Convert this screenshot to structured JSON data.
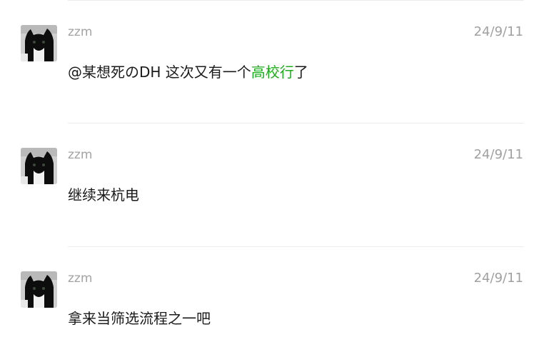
{
  "comments": [
    {
      "author": "zzm",
      "date": "24/9/11",
      "content_before": "@某想死のDH 这次又有一个",
      "content_link": "高校行",
      "content_after": "了"
    },
    {
      "author": "zzm",
      "date": "24/9/11",
      "content_before": "继续来杭电",
      "content_link": "",
      "content_after": ""
    },
    {
      "author": "zzm",
      "date": "24/9/11",
      "content_before": "拿来当筛选流程之一吧",
      "content_link": "",
      "content_after": ""
    }
  ],
  "avatar_icon": "black-cat-avatar",
  "colors": {
    "link": "#1aad19",
    "meta_text": "#a3a3a3",
    "body_text": "#1a1a1a",
    "divider": "#ececec"
  }
}
